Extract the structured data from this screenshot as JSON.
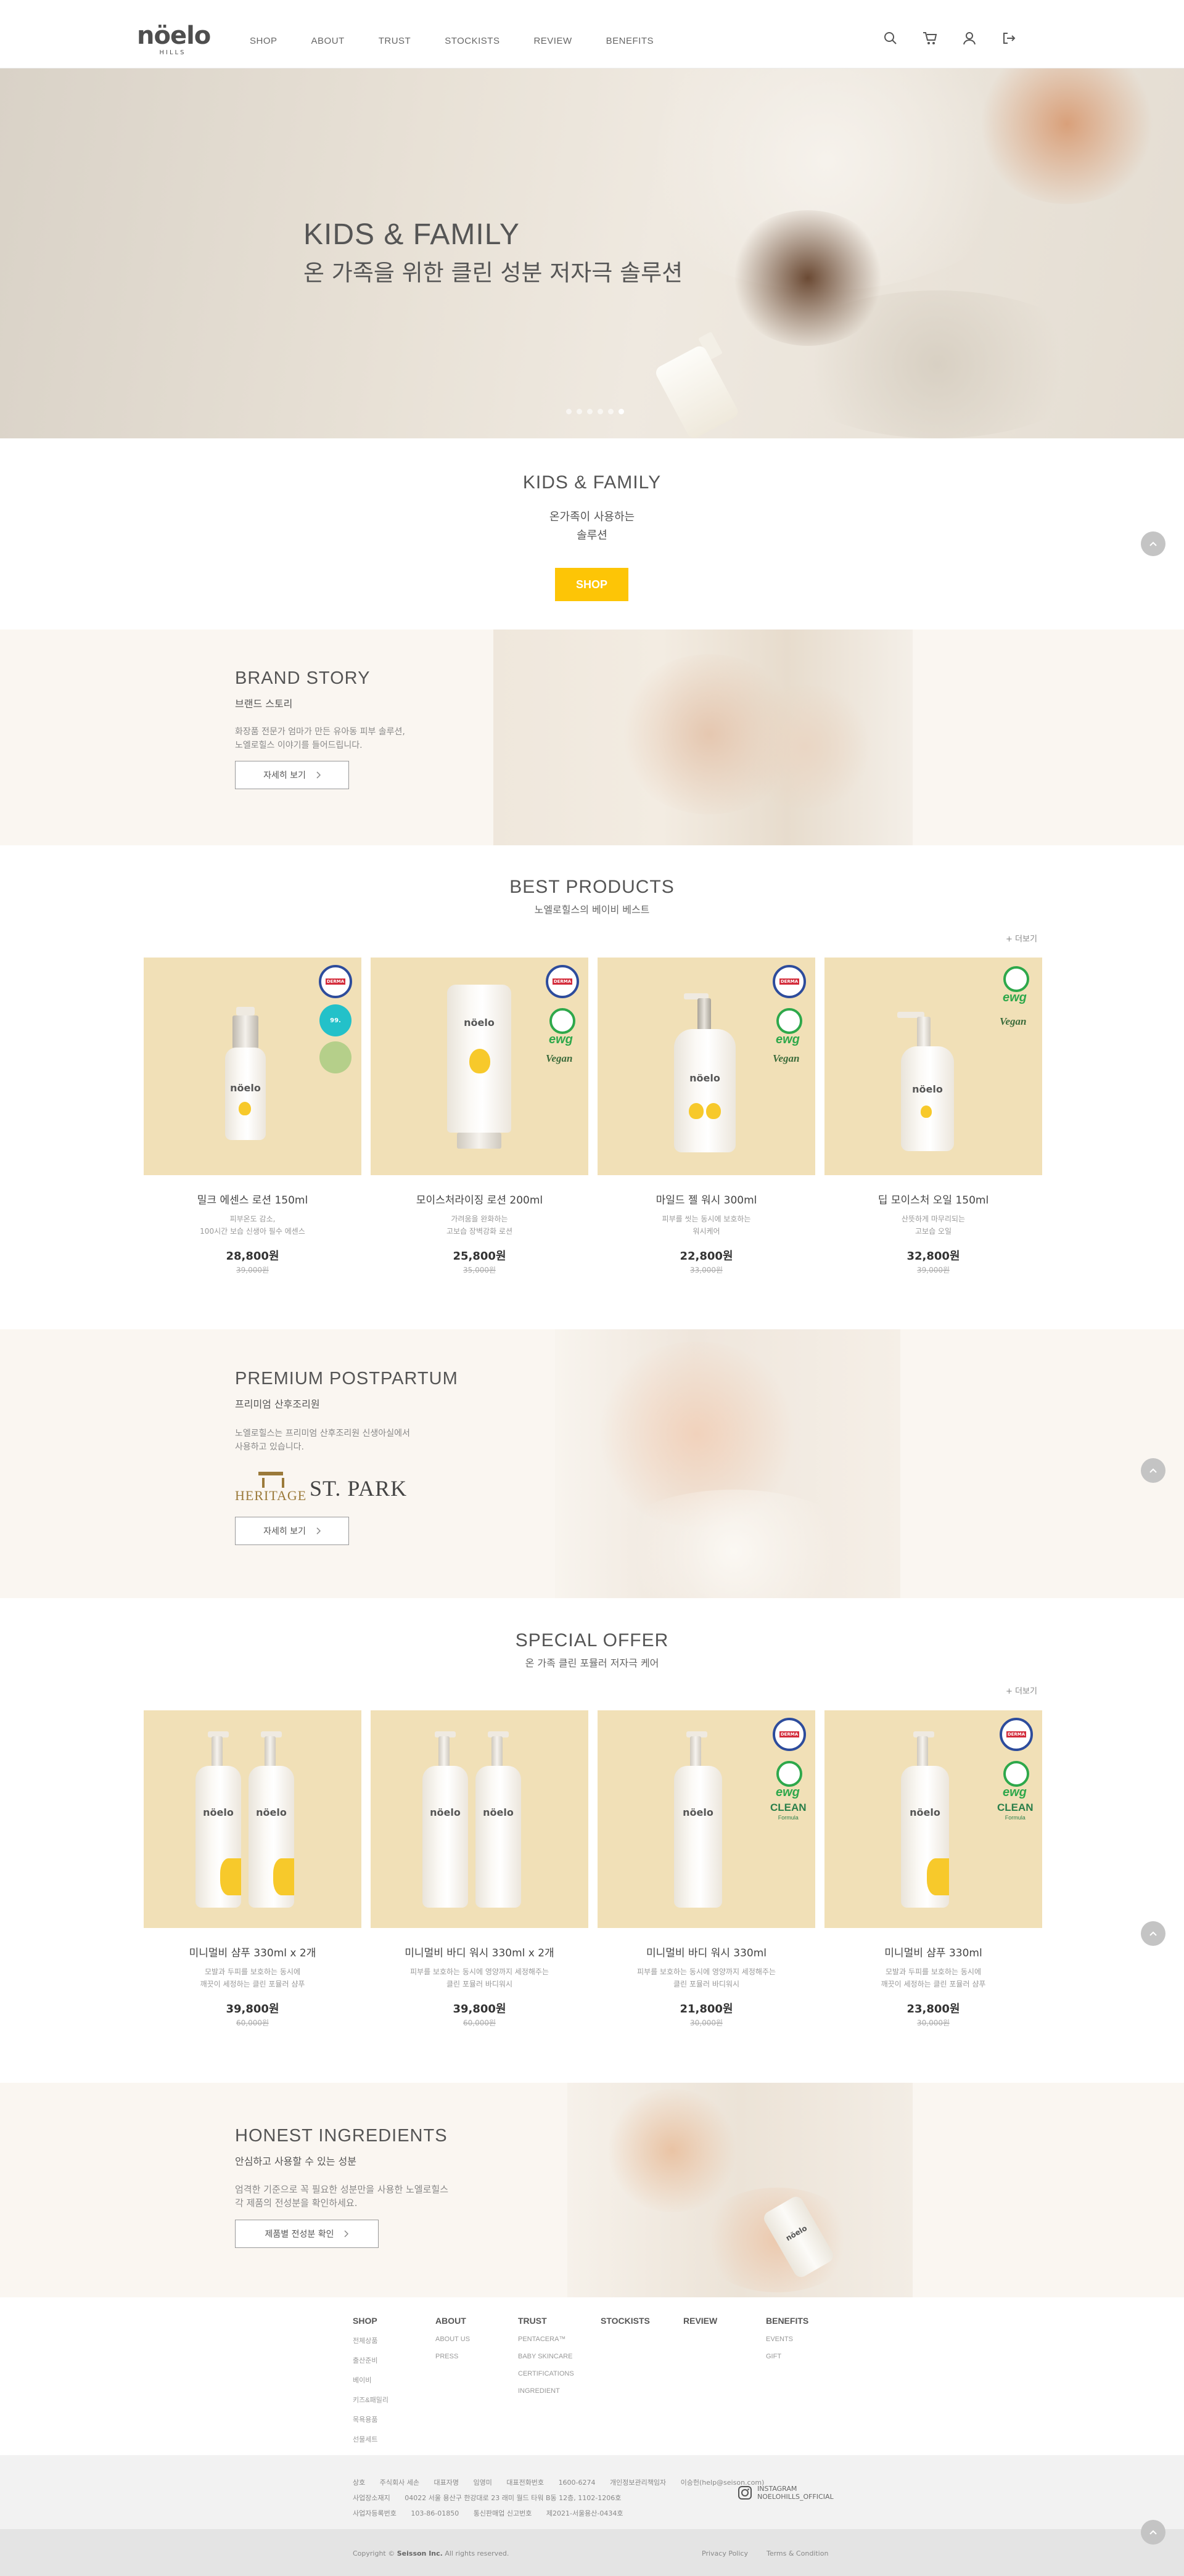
{
  "header": {
    "logo_main": "nöelo",
    "logo_sub": "HILLS",
    "nav": [
      "SHOP",
      "ABOUT",
      "TRUST",
      "STOCKISTS",
      "REVIEW",
      "BENEFITS"
    ],
    "icons": [
      "search-icon",
      "cart-icon",
      "user-icon",
      "logout-icon"
    ]
  },
  "hero": {
    "title1": "KIDS & FAMILY",
    "title2": "온 가족을 위한 클린 성분 저자극 솔루션",
    "bottle_label": "nöelo",
    "slides": 6,
    "active_slide": 5
  },
  "kids": {
    "title": "KIDS & FAMILY",
    "sub1": "온가족이 사용하는",
    "sub2": "솔루션",
    "button": "SHOP"
  },
  "brand_story": {
    "title": "BRAND STORY",
    "sub": "브랜드 스토리",
    "desc": "화장품 전문가 엄마가 만든 유아동 피부 솔루션,\n노엘로힐스 이야기를 들어드립니다.",
    "button": "자세히 보기"
  },
  "best": {
    "title": "BEST PRODUCTS",
    "sub": "노엘로힐스의 베이비 베스트",
    "more": "+ 더보기",
    "products": [
      {
        "name": "밀크 에센스 로션 150ml",
        "desc": "피부온도 감소,\n100시간 보습 신생아 필수 에센스",
        "price": "28,800원",
        "orig": "39,000원",
        "label": "nöelo"
      },
      {
        "name": "모이스처라이징 로션 200ml",
        "desc": "가려움을 완화하는\n고보습 장벽강화 로션",
        "price": "25,800원",
        "orig": "35,000원",
        "label": "nöelo"
      },
      {
        "name": "마일드 젤 워시 300ml",
        "desc": "피부를 씻는 동시에 보호하는\n워시케어",
        "price": "22,800원",
        "orig": "33,000원",
        "label": "nöelo"
      },
      {
        "name": "딥 모이스처 오일 150ml",
        "desc": "산뜻하게 마무리되는\n고보습 오일",
        "price": "32,800원",
        "orig": "39,000원",
        "label": "nöelo"
      }
    ]
  },
  "postpartum": {
    "title": "PREMIUM POSTPARTUM",
    "sub": "프리미엄 산후조리원",
    "desc": "노엘로힐스는 프리미엄 산후조리원 신생아실에서\n사용하고 있습니다.",
    "logo1": "HERITAGE",
    "logo2": "ST. PARK",
    "button": "자세히 보기"
  },
  "special": {
    "title": "SPECIAL OFFER",
    "sub": "온 가족 클린 포뮬러 저자극 케어",
    "more": "+ 더보기",
    "products": [
      {
        "name": "미니멀비 샴푸 330ml x 2개",
        "desc": "모발과 두피를 보호하는 동시에\n깨끗이 세정하는 클린 포뮬러 샴푸",
        "price": "39,800원",
        "orig": "60,000원",
        "label": "nöelo"
      },
      {
        "name": "미니멀비 바디 워시 330ml x 2개",
        "desc": "피부를 보호하는 동시에 영양까지 세정해주는\n클린 포뮬러 바디워시",
        "price": "39,800원",
        "orig": "60,000원",
        "label": "nöelo"
      },
      {
        "name": "미니멀비 바디 워시 330ml",
        "desc": "피부를 보호하는 동시에 영양까지 세정해주는\n클린 포뮬러 바디워시",
        "price": "21,800원",
        "orig": "30,000원",
        "label": "nöelo"
      },
      {
        "name": "미니멀비 샴푸 330ml",
        "desc": "모발과 두피를 보호하는 동시에\n깨끗이 세정하는 클린 포뮬러 샴푸",
        "price": "23,800원",
        "orig": "30,000원",
        "label": "nöelo"
      }
    ]
  },
  "ingredients": {
    "title": "HONEST INGREDIENTS",
    "sub": "안심하고 사용할 수 있는 성분",
    "desc": "엄격한 기준으로 꼭 필요한 성분만을 사용한 노엘로힐스\n각 제품의 전성분을 확인하세요.",
    "button": "제품별 전성분 확인",
    "bottle_label": "nöelo"
  },
  "badges": {
    "derma": "DERMA",
    "cyan_value": "99.",
    "ewg": "ewg",
    "vegan": "Vegan",
    "clean": "CLEAN",
    "clean_sub": "Formula"
  },
  "footer": {
    "columns": [
      {
        "head": "SHOP",
        "items": [
          "전체상품",
          "출산준비",
          "베이비",
          "키즈&패밀리",
          "목욕용품",
          "선물세트"
        ]
      },
      {
        "head": "ABOUT",
        "items": [
          "ABOUT US",
          "PRESS"
        ]
      },
      {
        "head": "TRUST",
        "items": [
          "PENTACERA™",
          "BABY SKINCARE",
          "CERTIFICATIONS",
          "INGREDIENT"
        ]
      },
      {
        "head": "STOCKISTS",
        "items": []
      },
      {
        "head": "REVIEW",
        "items": []
      },
      {
        "head": "BENEFITS",
        "items": [
          "EVENTS",
          "GIFT"
        ]
      }
    ],
    "info_row1": [
      "상호",
      "주식회사 세손",
      "대표자명",
      "임영미",
      "대표전화번호",
      "1600-6274",
      "개인정보관리책임자",
      "이승헌(help@seison.com)"
    ],
    "info_row2": [
      "사업장소재지",
      "04022 서울 용산구 한강대로 23 래미 월드 타워 B동 12층, 1102-1206호"
    ],
    "info_row3": [
      "사업자등록번호",
      "103-86-01850",
      "통신판매업 신고번호",
      "제2021-서울용산-0434호"
    ],
    "instagram1": "INSTAGRAM",
    "instagram2": "NOELOHILLS_OFFICIAL",
    "copyright_pre": "Copyright ©",
    "copyright_brand": "Seisson Inc.",
    "copyright_post": "All rights reserved.",
    "policy": [
      "Privacy Policy",
      "Terms & Condition"
    ]
  }
}
